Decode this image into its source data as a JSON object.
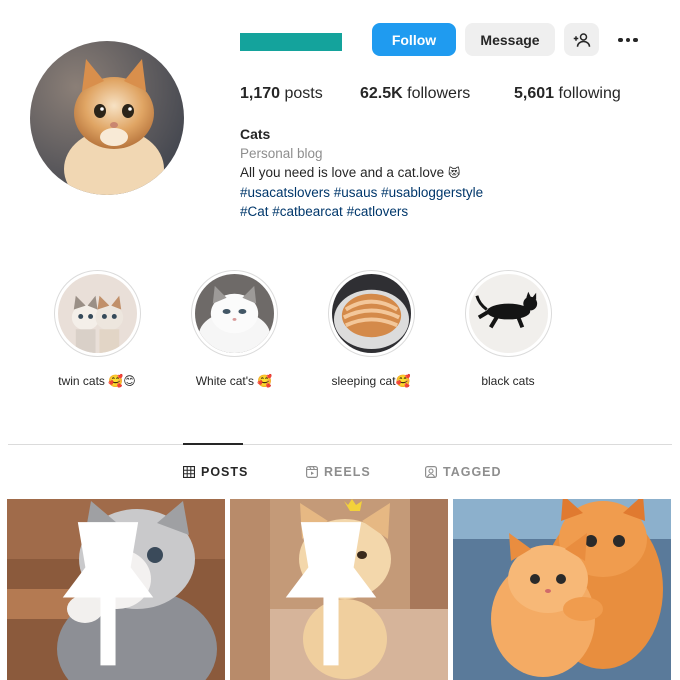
{
  "profile": {
    "username_redaction_color": "#14a39c",
    "avatar_icon": "kitten-avatar"
  },
  "actions": {
    "follow_label": "Follow",
    "follow_color": "#1f9bf0",
    "message_label": "Message",
    "add_user_icon": "add-user-icon",
    "more_icon": "more-options-icon"
  },
  "stats": {
    "posts_count": "1,170",
    "posts_label": " posts",
    "followers_count": "62.5K",
    "followers_label": " followers",
    "following_count": "5,601",
    "following_label": " following"
  },
  "bio": {
    "name": "Cats",
    "category": "Personal blog",
    "text": "All you need is love and a cat.love",
    "text_emoji": "😻",
    "hashtags_line1": "#usacatslovers #usaus #usabloggerstyle",
    "hashtags_line2": "#Cat #catbearcat #catlovers"
  },
  "highlights": [
    {
      "label": "twin cats",
      "emoji": "🥰😊"
    },
    {
      "label": "White cat's",
      "emoji": "🥰"
    },
    {
      "label": "sleeping cat",
      "emoji": "🥰"
    },
    {
      "label": "black cats",
      "emoji": ""
    }
  ],
  "tabs": [
    {
      "label": "POSTS",
      "icon": "grid-icon",
      "active": true
    },
    {
      "label": "REELS",
      "icon": "reels-icon",
      "active": false
    },
    {
      "label": "TAGGED",
      "icon": "tagged-icon",
      "active": false
    }
  ],
  "posts": [
    {
      "subject": "grey-white-kitten",
      "pinned": true
    },
    {
      "subject": "ginger-kitten-crown",
      "pinned": true
    },
    {
      "subject": "two-ginger-kittens-hugging",
      "pinned": false
    }
  ]
}
